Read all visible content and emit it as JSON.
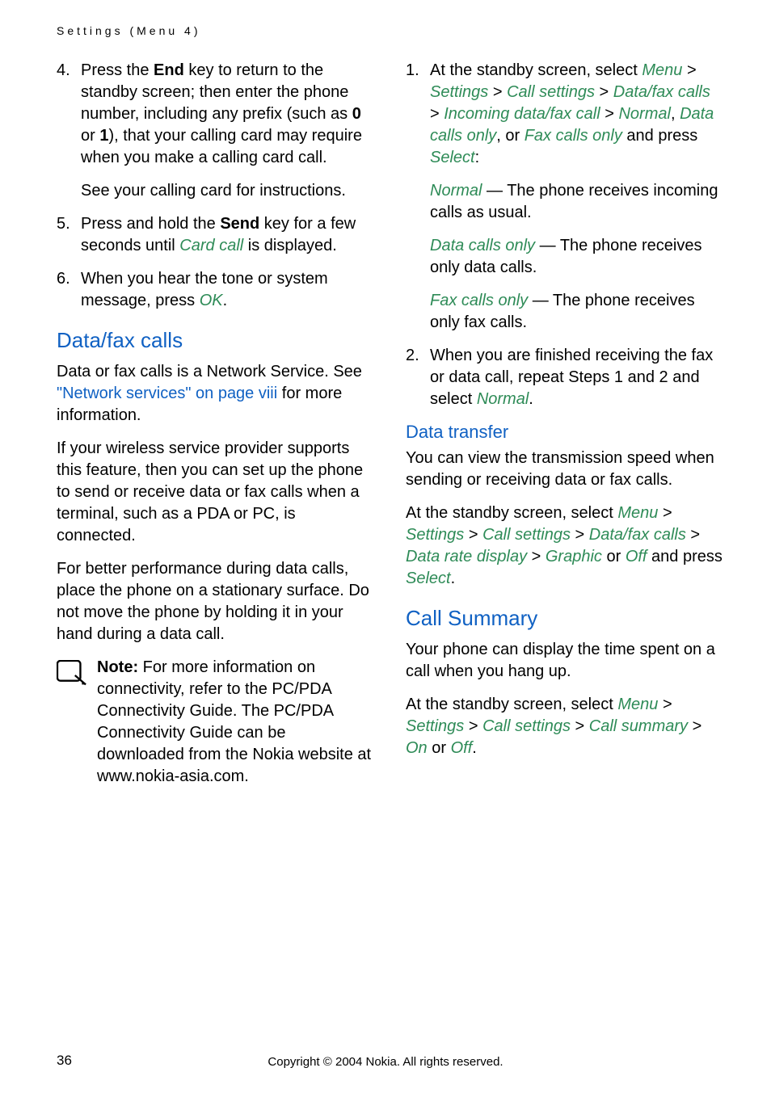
{
  "header": "Settings (Menu 4)",
  "left": {
    "step4": {
      "num": "4.",
      "text_a": "Press the ",
      "end": "End",
      "text_b": " key to return to the standby screen; then enter the phone number, including any prefix (such as ",
      "zero": "0",
      "text_c": " or ",
      "one": "1",
      "text_d": "), that your calling card may require when you make a calling card call."
    },
    "see_card": "See your calling card for instructions.",
    "step5": {
      "num": "5.",
      "text_a": "Press and hold the ",
      "send": "Send",
      "text_b": " key for a few seconds until ",
      "card_call": "Card call",
      "text_c": " is displayed."
    },
    "step6": {
      "num": "6.",
      "text_a": "When you hear the tone or system message, press ",
      "ok": "OK",
      "text_b": "."
    },
    "h2_datafax": "Data/fax calls",
    "df_p1_a": "Data or fax calls is a Network Service. See ",
    "df_p1_link": "\"Network services\" on page viii",
    "df_p1_b": " for more information.",
    "df_p2": "If your wireless service provider supports this feature, then you can set up the phone to send or receive data or fax calls when a terminal, such as a PDA or PC, is connected.",
    "df_p3": "For better performance during data calls, place the phone on a stationary surface. Do not move the phone by holding it in your hand during a data call.",
    "note_label": "Note:",
    "note_text": " For more information on connectivity, refer to the PC/PDA Connectivity Guide. The PC/PDA Connectivity Guide can be downloaded from the Nokia website at www.nokia-asia.com."
  },
  "right": {
    "step1": {
      "num": "1.",
      "text_a": "At the standby screen, select ",
      "menu": "Menu",
      "gt1": " > ",
      "settings": "Settings",
      "gt2": " > ",
      "callsettings": "Call settings",
      "gt3": " > ",
      "datafaxcalls": "Data/fax calls",
      "gt4": " > ",
      "incoming": "Incoming data/fax call",
      "gt5": " > ",
      "normal": "Normal",
      "comma": ", ",
      "dataonly": "Data calls only",
      "comma_or": ", or ",
      "faxonly": "Fax calls only",
      "text_b": " and press ",
      "select": "Select",
      "colon": ":"
    },
    "normal_desc_a": "Normal",
    "normal_desc_b": " — The phone receives incoming calls as usual.",
    "data_desc_a": "Data calls only",
    "data_desc_b": " — The phone receives only data calls.",
    "fax_desc_a": "Fax calls only",
    "fax_desc_b": " — The phone receives only fax calls.",
    "step2": {
      "num": "2.",
      "text_a": "When you are finished receiving the fax or data call, repeat Steps 1 and 2 and select ",
      "normal": "Normal",
      "text_b": "."
    },
    "h3_datatransfer": "Data transfer",
    "dt_p1": "You can view the transmission speed when sending or receiving data or fax calls.",
    "dt_p2_a": "At the standby screen, select ",
    "dt_menu": "Menu",
    "dt_gt1": " > ",
    "dt_settings": "Settings",
    "dt_gt2": " > ",
    "dt_callsettings": "Call settings",
    "dt_gt3": " > ",
    "dt_datafax": "Data/fax calls",
    "dt_gt4": " > ",
    "dt_datarate": "Data rate display",
    "dt_gt5": " > ",
    "dt_graphic": "Graphic",
    "dt_or": " or ",
    "dt_off": "Off",
    "dt_and": " and press ",
    "dt_select": "Select",
    "dt_period": ".",
    "h2_callsummary": "Call Summary",
    "cs_p1": "Your phone can display the time spent on a call when you hang up.",
    "cs_p2_a": "At the standby screen, select ",
    "cs_menu": "Menu",
    "cs_gt1": " > ",
    "cs_settings": "Settings",
    "cs_gt2": " > ",
    "cs_callsettings": "Call settings",
    "cs_gt3": " > ",
    "cs_callsummary": "Call summary",
    "cs_gt4": " > ",
    "cs_on": "On",
    "cs_or": " or ",
    "cs_off": "Off",
    "cs_period": "."
  },
  "footer": {
    "page_num": "36",
    "copyright": "Copyright © 2004 Nokia. All rights reserved."
  }
}
